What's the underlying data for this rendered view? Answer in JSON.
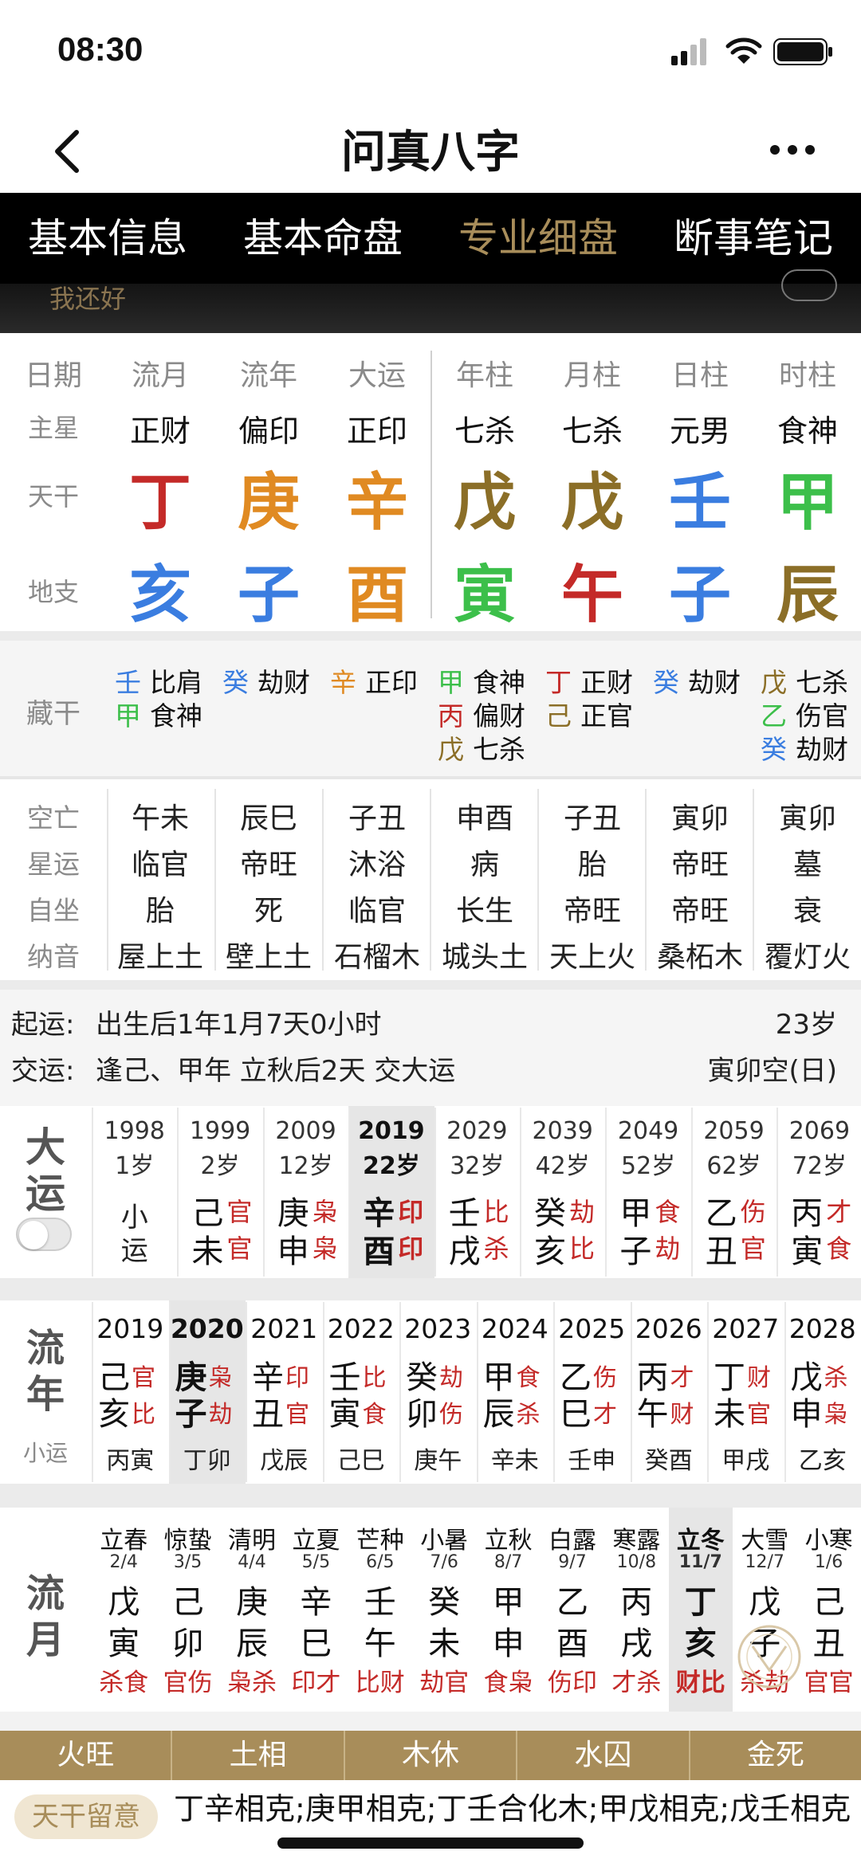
{
  "status": {
    "time": "08:30"
  },
  "nav": {
    "title": "问真八字"
  },
  "tabs": [
    "基本信息",
    "基本命盘",
    "专业细盘",
    "断事笔记"
  ],
  "banner": {
    "text": "我还好"
  },
  "pillars": {
    "headers": [
      "日期",
      "流月",
      "流年",
      "大运",
      "年柱",
      "月柱",
      "日柱",
      "时柱"
    ],
    "zhuxing_label": "主星",
    "zhuxing": [
      "正财",
      "偏印",
      "正印",
      "七杀",
      "七杀",
      "元男",
      "食神"
    ],
    "tiangan_label": "天干",
    "tiangan": [
      {
        "c": "丁",
        "col": "red"
      },
      {
        "c": "庚",
        "col": "orange"
      },
      {
        "c": "辛",
        "col": "orange"
      },
      {
        "c": "戊",
        "col": "olive"
      },
      {
        "c": "戊",
        "col": "olive"
      },
      {
        "c": "壬",
        "col": "blue"
      },
      {
        "c": "甲",
        "col": "green"
      }
    ],
    "dizhi_label": "地支",
    "dizhi": [
      {
        "c": "亥",
        "col": "blue"
      },
      {
        "c": "子",
        "col": "blue"
      },
      {
        "c": "酉",
        "col": "orange"
      },
      {
        "c": "寅",
        "col": "green"
      },
      {
        "c": "午",
        "col": "red"
      },
      {
        "c": "子",
        "col": "blue"
      },
      {
        "c": "辰",
        "col": "olive"
      }
    ]
  },
  "canggan": {
    "label": "藏干",
    "cols": [
      [
        {
          "g": "壬",
          "col": "blue",
          "s": "比肩"
        },
        {
          "g": "甲",
          "col": "green",
          "s": "食神"
        }
      ],
      [
        {
          "g": "癸",
          "col": "blue",
          "s": "劫财"
        }
      ],
      [
        {
          "g": "辛",
          "col": "orange",
          "s": "正印"
        }
      ],
      [
        {
          "g": "甲",
          "col": "green",
          "s": "食神"
        },
        {
          "g": "丙",
          "col": "red",
          "s": "偏财"
        },
        {
          "g": "戊",
          "col": "olive",
          "s": "七杀"
        }
      ],
      [
        {
          "g": "丁",
          "col": "red",
          "s": "正财"
        },
        {
          "g": "己",
          "col": "olive",
          "s": "正官"
        }
      ],
      [
        {
          "g": "癸",
          "col": "blue",
          "s": "劫财"
        }
      ],
      [
        {
          "g": "戊",
          "col": "olive",
          "s": "七杀"
        },
        {
          "g": "乙",
          "col": "green",
          "s": "伤官"
        },
        {
          "g": "癸",
          "col": "blue",
          "s": "劫财"
        }
      ]
    ]
  },
  "info": {
    "labels": [
      "空亡",
      "星运",
      "自坐",
      "纳音"
    ],
    "rows": [
      [
        "午未",
        "辰巳",
        "子丑",
        "申酉",
        "子丑",
        "寅卯",
        "寅卯"
      ],
      [
        "临官",
        "帝旺",
        "沐浴",
        "病",
        "胎",
        "帝旺",
        "墓"
      ],
      [
        "胎",
        "死",
        "临官",
        "长生",
        "帝旺",
        "帝旺",
        "衰"
      ],
      [
        "屋上土",
        "壁上土",
        "石榴木",
        "城头土",
        "天上火",
        "桑柘木",
        "覆灯火"
      ]
    ]
  },
  "qiyun": {
    "line1_label": "起运:",
    "line1_text": "出生后1年1月7天0小时",
    "line1_right": "23岁",
    "line2_label": "交运:",
    "line2_text": "逢己、甲年 立秋后2天 交大运",
    "line2_right": "寅卯空(日)"
  },
  "dayun": {
    "label_a": "大",
    "label_b": "运",
    "cols": [
      {
        "y": "1998",
        "age": "1岁",
        "g": "小",
        "z": "运",
        "tg": "",
        "tz": ""
      },
      {
        "y": "1999",
        "age": "2岁",
        "g": "己",
        "z": "未",
        "tg": "官",
        "tz": "官"
      },
      {
        "y": "2009",
        "age": "12岁",
        "g": "庚",
        "z": "申",
        "tg": "枭",
        "tz": "枭"
      },
      {
        "y": "2019",
        "age": "22岁",
        "g": "辛",
        "z": "酉",
        "tg": "印",
        "tz": "印"
      },
      {
        "y": "2029",
        "age": "32岁",
        "g": "壬",
        "z": "戌",
        "tg": "比",
        "tz": "杀"
      },
      {
        "y": "2039",
        "age": "42岁",
        "g": "癸",
        "z": "亥",
        "tg": "劫",
        "tz": "比"
      },
      {
        "y": "2049",
        "age": "52岁",
        "g": "甲",
        "z": "子",
        "tg": "食",
        "tz": "劫"
      },
      {
        "y": "2059",
        "age": "62岁",
        "g": "乙",
        "z": "丑",
        "tg": "伤",
        "tz": "官"
      },
      {
        "y": "2069",
        "age": "72岁",
        "g": "丙",
        "z": "寅",
        "tg": "才",
        "tz": "食"
      }
    ]
  },
  "liunian": {
    "label_a": "流",
    "label_b": "年",
    "xiaoyun": "小运",
    "cols": [
      {
        "y": "2019",
        "g": "己",
        "z": "亥",
        "tg": "官",
        "tz": "比",
        "x": "丙寅"
      },
      {
        "y": "2020",
        "g": "庚",
        "z": "子",
        "tg": "枭",
        "tz": "劫",
        "x": "丁卯"
      },
      {
        "y": "2021",
        "g": "辛",
        "z": "丑",
        "tg": "印",
        "tz": "官",
        "x": "戊辰"
      },
      {
        "y": "2022",
        "g": "壬",
        "z": "寅",
        "tg": "比",
        "tz": "食",
        "x": "己巳"
      },
      {
        "y": "2023",
        "g": "癸",
        "z": "卯",
        "tg": "劫",
        "tz": "伤",
        "x": "庚午"
      },
      {
        "y": "2024",
        "g": "甲",
        "z": "辰",
        "tg": "食",
        "tz": "杀",
        "x": "辛未"
      },
      {
        "y": "2025",
        "g": "乙",
        "z": "巳",
        "tg": "伤",
        "tz": "才",
        "x": "壬申"
      },
      {
        "y": "2026",
        "g": "丙",
        "z": "午",
        "tg": "才",
        "tz": "财",
        "x": "癸酉"
      },
      {
        "y": "2027",
        "g": "丁",
        "z": "未",
        "tg": "财",
        "tz": "官",
        "x": "甲戌"
      },
      {
        "y": "2028",
        "g": "戊",
        "z": "申",
        "tg": "杀",
        "tz": "枭",
        "x": "乙亥"
      }
    ]
  },
  "liuyue": {
    "label_a": "流",
    "label_b": "月",
    "cols": [
      {
        "jq": "立春",
        "d": "2/4",
        "g": "戊",
        "z": "寅",
        "ss": "杀食"
      },
      {
        "jq": "惊蛰",
        "d": "3/5",
        "g": "己",
        "z": "卯",
        "ss": "官伤"
      },
      {
        "jq": "清明",
        "d": "4/4",
        "g": "庚",
        "z": "辰",
        "ss": "枭杀"
      },
      {
        "jq": "立夏",
        "d": "5/5",
        "g": "辛",
        "z": "巳",
        "ss": "印才"
      },
      {
        "jq": "芒种",
        "d": "6/5",
        "g": "壬",
        "z": "午",
        "ss": "比财"
      },
      {
        "jq": "小暑",
        "d": "7/6",
        "g": "癸",
        "z": "未",
        "ss": "劫官"
      },
      {
        "jq": "立秋",
        "d": "8/7",
        "g": "甲",
        "z": "申",
        "ss": "食枭"
      },
      {
        "jq": "白露",
        "d": "9/7",
        "g": "乙",
        "z": "酉",
        "ss": "伤印"
      },
      {
        "jq": "寒露",
        "d": "10/8",
        "g": "丙",
        "z": "戌",
        "ss": "才杀"
      },
      {
        "jq": "立冬",
        "d": "11/7",
        "g": "丁",
        "z": "亥",
        "ss": "财比"
      },
      {
        "jq": "大雪",
        "d": "12/7",
        "g": "戊",
        "z": "子",
        "ss": "杀劫"
      },
      {
        "jq": "小寒",
        "d": "1/6",
        "g": "己",
        "z": "丑",
        "ss": "官官"
      }
    ]
  },
  "bar": [
    "火旺",
    "土相",
    "木休",
    "水囚",
    "金死"
  ],
  "tiangan_note": {
    "badge": "天干留意",
    "text": "丁辛相克;庚甲相克;丁壬合化木;甲戊相克;戊壬相克"
  }
}
